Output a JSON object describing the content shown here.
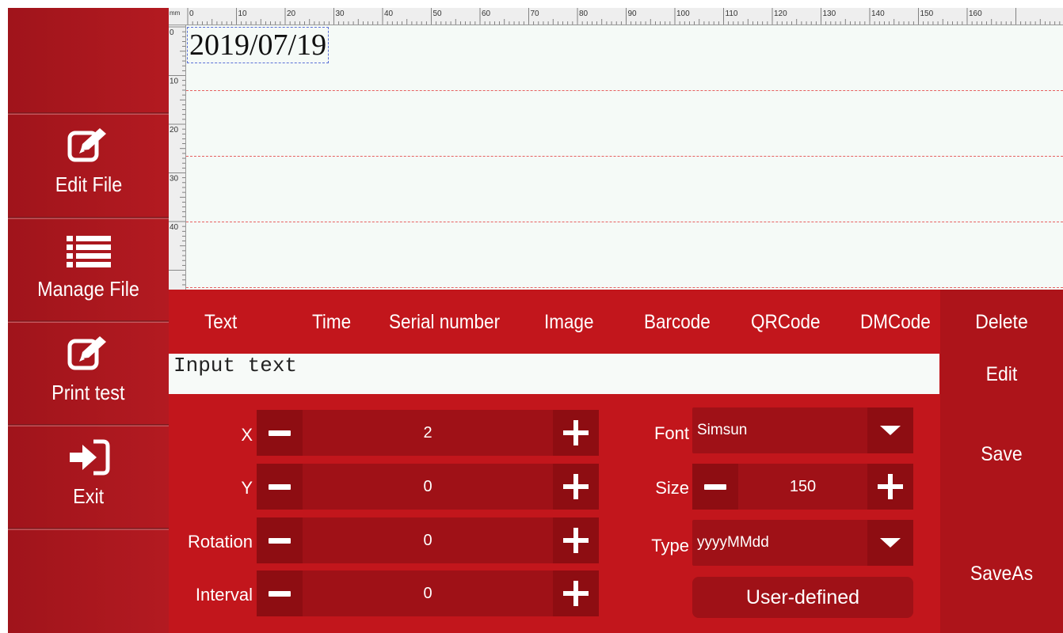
{
  "sidebar": {
    "items": [
      {
        "label": "Edit  File",
        "icon": "edit-icon"
      },
      {
        "label": "Manage  File",
        "icon": "list-icon"
      },
      {
        "label": "Print  test",
        "icon": "edit-icon"
      },
      {
        "label": "Exit",
        "icon": "exit-icon"
      }
    ]
  },
  "ruler": {
    "unit": "mm",
    "top_ticks": [
      "0",
      "10",
      "20",
      "30",
      "40",
      "50",
      "60",
      "70",
      "80",
      "90",
      "100",
      "110",
      "120",
      "130",
      "140",
      "150",
      "160"
    ],
    "left_ticks": [
      "0",
      "10",
      "20",
      "30",
      "40"
    ]
  },
  "canvas": {
    "text_object": "2019/07/19"
  },
  "tabs": [
    "Text",
    "Time",
    "Serial  number",
    "Image",
    "Barcode",
    "QRCode",
    "DMCode"
  ],
  "actions": {
    "delete": "Delete",
    "edit": "Edit",
    "save": "Save",
    "save_as": "SaveAs"
  },
  "input": {
    "value": "Input  text"
  },
  "fields": {
    "x": {
      "label": "X",
      "value": "2"
    },
    "y": {
      "label": "Y",
      "value": "0"
    },
    "rotation": {
      "label": "Rotation",
      "value": "0"
    },
    "interval": {
      "label": "Interval",
      "value": "0"
    },
    "font": {
      "label": "Font",
      "value": "Simsun"
    },
    "size": {
      "label": "Size",
      "value": "150"
    },
    "type": {
      "label": "Type",
      "value": "yyyyMMdd"
    }
  },
  "user_defined_label": "User-defined",
  "colors": {
    "panel_red": "#c2161c",
    "sidebar_red": "#a0141b",
    "canvas_bg": "#f5faf7",
    "dash_red": "#e66060",
    "selection_blue": "#5a6fd6"
  }
}
